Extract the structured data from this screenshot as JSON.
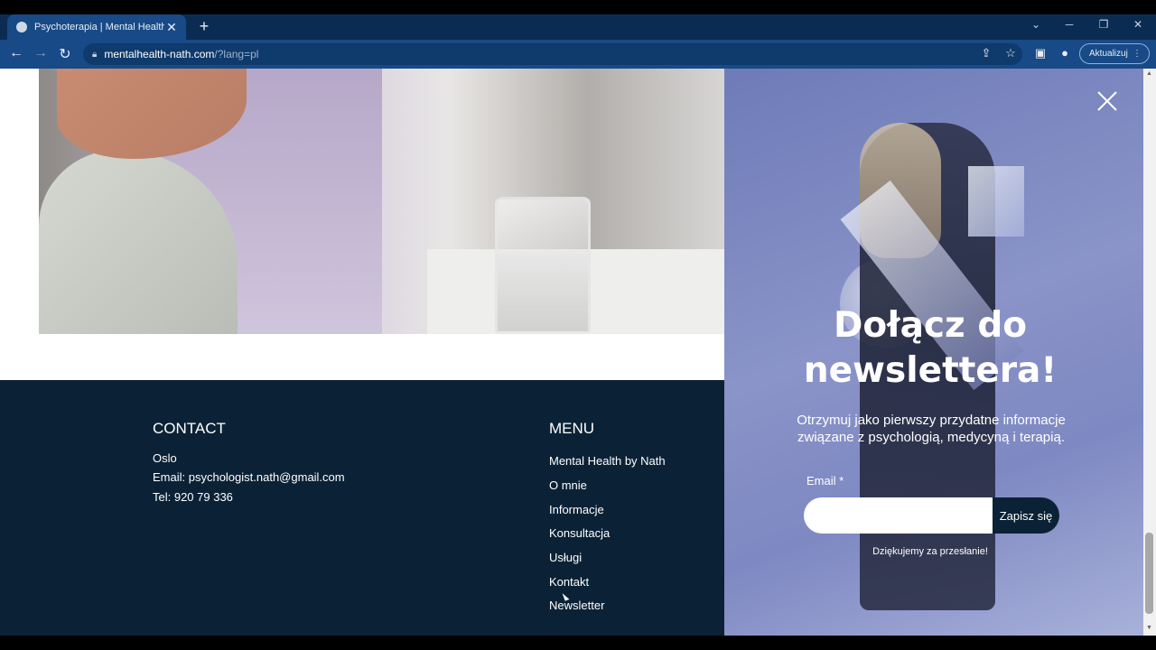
{
  "browser": {
    "tab_title": "Psychoterapia | Mental Health by Nath",
    "url_host": "mentalhealth-nath.com",
    "url_path": "/?lang=pl",
    "update_label": "Aktualizuj",
    "icons": [
      "back-icon",
      "forward-icon",
      "reload-icon",
      "lock-icon",
      "share-icon",
      "star-icon",
      "sidepanel-icon",
      "profile-icon",
      "menu-icon"
    ]
  },
  "footer": {
    "contact_title": "CONTACT",
    "contact_lines": [
      "Oslo",
      "Email: psychologist.nath@gmail.com",
      "Tel: 920 79 336"
    ],
    "menu_title": "MENU",
    "menu_items": [
      "Mental Health by Nath",
      "O mnie",
      "Informacje",
      "Konsultacja",
      "Usługi",
      "Kontakt",
      "Newsletter"
    ]
  },
  "popup": {
    "title": "Dołącz do newslettera!",
    "description": "Otrzymuj jako pierwszy przydatne informacje związane z psychologią, medycyną i terapią.",
    "email_label": "Email *",
    "email_value": "",
    "subscribe_label": "Zapisz się",
    "thanks_text": "Dziękujemy za przesłanie!"
  },
  "colors": {
    "chrome": "#174a86",
    "footer_bg": "#0b2236",
    "popup_accent": "#7e88c2"
  }
}
